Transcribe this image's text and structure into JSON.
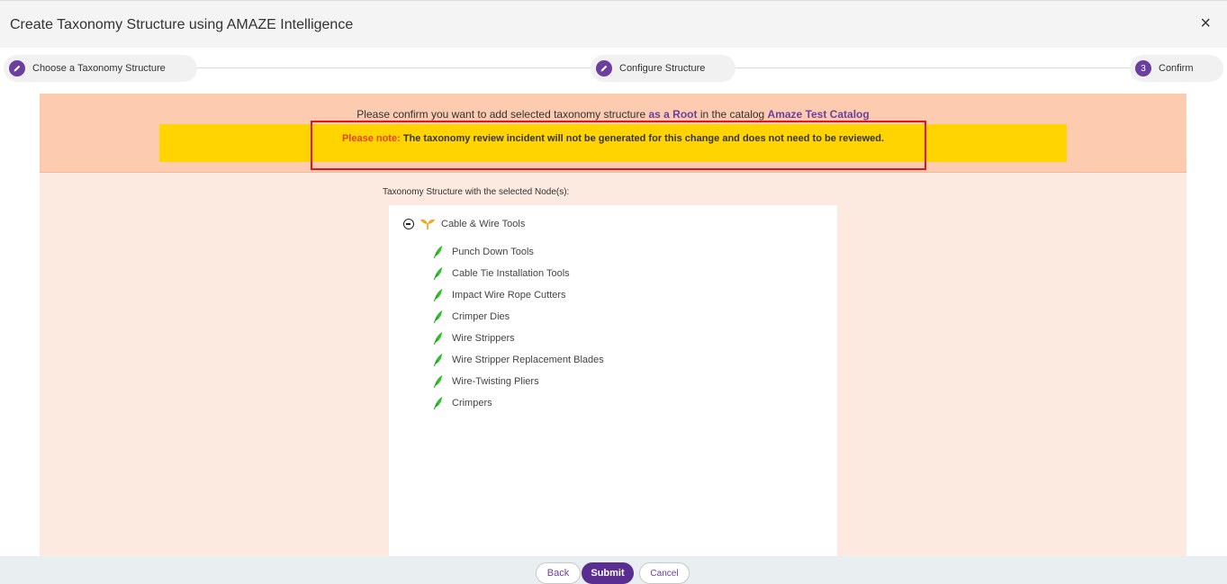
{
  "window": {
    "title": "Create Taxonomy Structure using AMAZE Intelligence",
    "close_symbol": "×"
  },
  "stepper": {
    "steps": [
      {
        "label": "Choose a Taxonomy Structure",
        "icon": "pencil-icon"
      },
      {
        "label": "Configure Structure",
        "icon": "pencil-icon"
      },
      {
        "label": "Confirm",
        "number": "3"
      }
    ],
    "accent_color": "#6b3fa0"
  },
  "confirm": {
    "text_before": "Please confirm you want to add selected taxonomy structure ",
    "root_link": "as a Root",
    "text_middle": " in the catalog ",
    "catalog_link": "Amaze Test Catalog",
    "note_label": "Please note:",
    "note_text": " The taxonomy review incident will not be generated for this change and does not need to be reviewed."
  },
  "tree": {
    "label": "Taxonomy Structure with the selected Node(s):",
    "root": {
      "label": "Cable & Wire Tools",
      "icon": "sprout-icon"
    },
    "children": [
      "Punch Down Tools",
      "Cable Tie Installation Tools",
      "Impact Wire Rope Cutters",
      "Crimper Dies",
      "Wire Strippers",
      "Wire Stripper Replacement Blades",
      "Wire-Twisting Pliers",
      "Crimpers"
    ]
  },
  "footer": {
    "back_label": "Back",
    "submit_label": "Submit",
    "cancel_label": "Cancel"
  },
  "colors": {
    "banner_bg": "#fdcbb0",
    "note_bg": "#ffd400",
    "note_label": "#e8411f",
    "highlight_border": "#e5131b",
    "primary": "#5a2d91"
  }
}
